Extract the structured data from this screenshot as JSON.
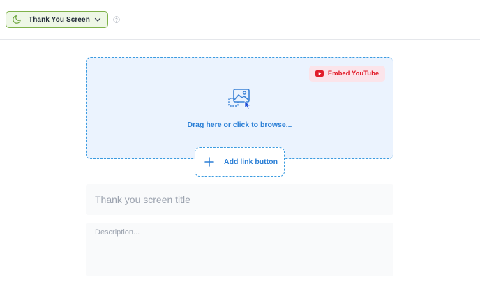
{
  "topbar": {
    "screen_selector": {
      "label": "Thank You Screen",
      "icon": "moon-icon"
    },
    "help_icon": "question-circle-icon"
  },
  "media": {
    "embed_youtube_label": "Embed YouTube",
    "drop_text": "Drag here or click to browse...",
    "icon": "image-upload-icon"
  },
  "link_button": {
    "label": "Add link button",
    "icon": "plus-icon"
  },
  "form": {
    "title_placeholder": "Thank you screen title",
    "title_value": "",
    "description_placeholder": "Description...",
    "description_value": ""
  },
  "colors": {
    "accent_green": "#7fb24a",
    "accent_blue": "#2b7fd6",
    "youtube_red": "#e11d2a"
  }
}
